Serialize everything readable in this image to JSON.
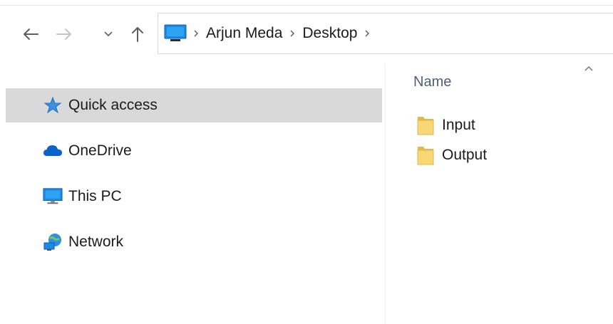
{
  "breadcrumb": {
    "root_icon": "this-pc-icon",
    "items": [
      "Arjun Meda",
      "Desktop"
    ]
  },
  "navigation": {
    "back_icon": "arrow-left-icon",
    "forward_icon": "arrow-right-icon",
    "recent_icon": "chevron-down-icon",
    "up_icon": "arrow-up-icon"
  },
  "sidebar": {
    "items": [
      {
        "label": "Quick access",
        "icon": "star-icon",
        "selected": true
      },
      {
        "label": "OneDrive",
        "icon": "cloud-icon",
        "selected": false
      },
      {
        "label": "This PC",
        "icon": "monitor-icon",
        "selected": false
      },
      {
        "label": "Network",
        "icon": "network-icon",
        "selected": false
      }
    ]
  },
  "content": {
    "column_name": "Name",
    "sort": "ascending",
    "files": [
      {
        "name": "Input",
        "type": "folder"
      },
      {
        "name": "Output",
        "type": "folder"
      }
    ]
  },
  "colors": {
    "selected_bg": "#d9d9d9",
    "folder_yellow": "#f8d775",
    "accent_blue": "#0078d7"
  }
}
